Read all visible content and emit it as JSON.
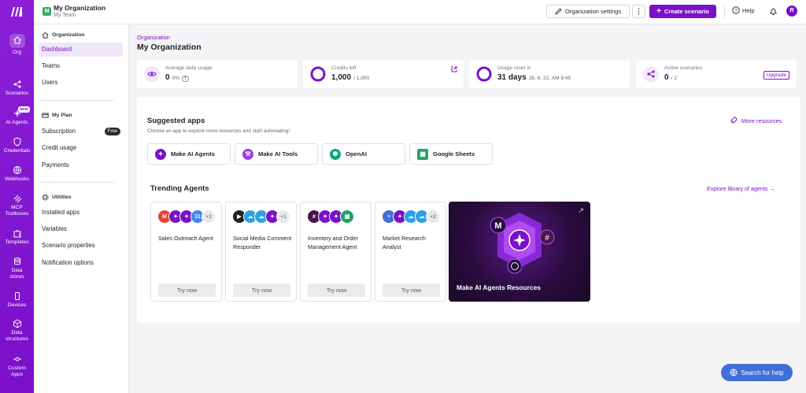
{
  "leftbar": {
    "items": [
      {
        "label": "Org",
        "icon": "home-icon"
      },
      {
        "label": "Scenarios",
        "icon": "share-icon"
      },
      {
        "label": "AI Agents",
        "icon": "ai-agents-icon",
        "badge": "NEW"
      },
      {
        "label": "Credentials",
        "icon": "shield-icon"
      },
      {
        "label": "Webhooks",
        "icon": "globe-icon"
      },
      {
        "label": "MCP Toolboxes",
        "icon": "mcp-icon"
      },
      {
        "label": "Templates",
        "icon": "puzzle-icon"
      },
      {
        "label": "Data stores",
        "icon": "database-icon"
      },
      {
        "label": "Devices",
        "icon": "phone-icon"
      },
      {
        "label": "Data structures",
        "icon": "cube-icon"
      },
      {
        "label": "Custom Apps",
        "icon": "plug-icon"
      }
    ]
  },
  "topbar": {
    "org_initial": "M",
    "org_name": "My Organization",
    "team_name": "My Team",
    "settings_label": "Organization settings",
    "dots": "⋮",
    "create_label": "Create scenario",
    "help_label": "Help",
    "user_initial": "R"
  },
  "sidebar": {
    "org_section": "Organization",
    "org_items": [
      "Dashboard",
      "Teams",
      "Users"
    ],
    "plan_section": "My Plan",
    "plan_items": [
      "Subscription",
      "Credit usage",
      "Payments"
    ],
    "free_badge": "Free",
    "util_section": "Utilities",
    "util_items": [
      "Installed apps",
      "Variables",
      "Scenario properties",
      "Notification options"
    ]
  },
  "main": {
    "breadcrumb": "Organization",
    "title": "My Organization",
    "stats": [
      {
        "label": "Average daily usage",
        "value": "0",
        "sub": "0%"
      },
      {
        "label": "Credits left",
        "value": "1,000",
        "sub": "/ 1,000"
      },
      {
        "label": "Usage reset in",
        "value": "31 days",
        "sub": "26. 6. 22. AM 9:45"
      },
      {
        "label": "Active scenarios",
        "value": "0",
        "sub": "/ 2",
        "action": "Upgrade"
      }
    ],
    "suggested": {
      "title": "Suggested apps",
      "subtitle": "Choose an app to explore more resources and start automating!",
      "more": "More resources",
      "apps": [
        "Make AI Agents",
        "Make AI Tools",
        "OpenAI",
        "Google Sheets"
      ]
    },
    "trending": {
      "title": "Trending Agents",
      "explore": "Explore library of agents →",
      "try_label": "Try now",
      "agents": [
        {
          "name": "Sales Outreach Agent",
          "more": "+2"
        },
        {
          "name": "Social Media Comment Responder",
          "more": "+1"
        },
        {
          "name": "Inventory and Order Management Agent",
          "more": ""
        },
        {
          "name": "Market Research Analyst",
          "more": "+2"
        }
      ],
      "promo": "Make AI Agents Resources"
    }
  },
  "help_button": "Search for help",
  "colors": {
    "brand": "#7a10c9",
    "help": "#3f6fd8"
  }
}
